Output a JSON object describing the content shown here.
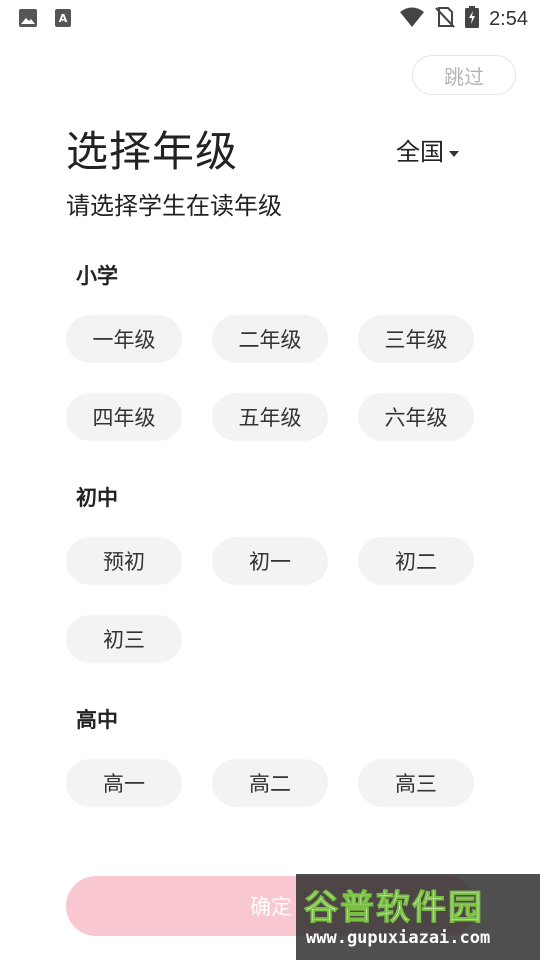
{
  "status_bar": {
    "time": "2:54",
    "left_icons": [
      "image-icon",
      "font-a-icon"
    ],
    "right_icons": [
      "wifi-icon",
      "no-sim-icon",
      "battery-charging-icon"
    ]
  },
  "header": {
    "skip_label": "跳过",
    "title": "选择年级",
    "region": "全国",
    "subtitle": "请选择学生在读年级"
  },
  "sections": [
    {
      "title": "小学",
      "grades": [
        "一年级",
        "二年级",
        "三年级",
        "四年级",
        "五年级",
        "六年级"
      ]
    },
    {
      "title": "初中",
      "grades": [
        "预初",
        "初一",
        "初二",
        "初三"
      ]
    },
    {
      "title": "高中",
      "grades": [
        "高一",
        "高二",
        "高三"
      ]
    }
  ],
  "confirm_label": "确定",
  "watermark": {
    "title": "谷普软件园",
    "url": "www.gupuxiazai.com"
  },
  "colors": {
    "chip_bg": "#f3f3f3",
    "confirm_disabled": "#f9c7cf",
    "skip_text": "#b5b5b5"
  }
}
